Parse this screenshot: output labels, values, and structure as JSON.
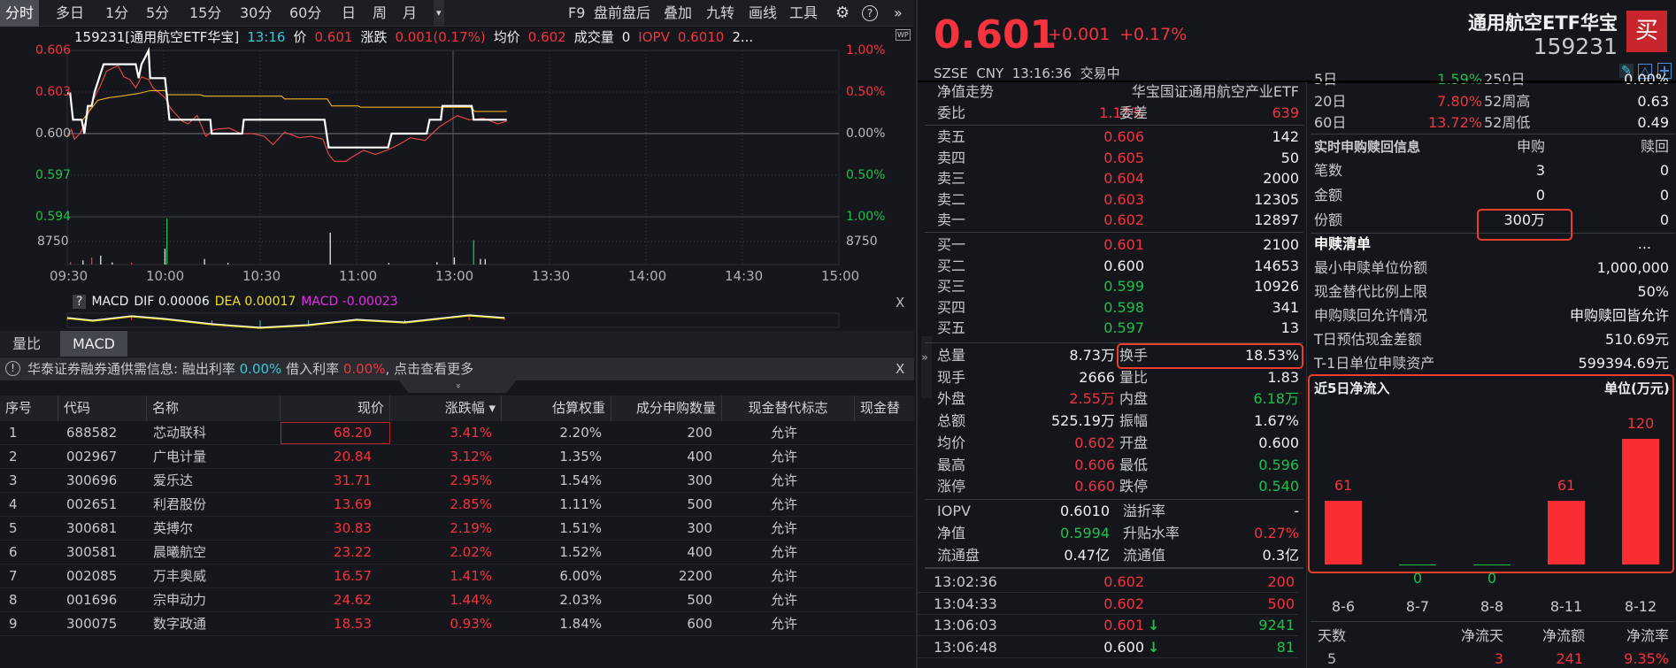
{
  "toolbar": {
    "tabs": [
      "分时",
      "多日",
      "1分",
      "5分",
      "15分",
      "30分",
      "60分",
      "日",
      "周",
      "月"
    ],
    "dropdown": "▾",
    "right_items": [
      "F9",
      "盘前盘后",
      "叠加",
      "九转",
      "画线",
      "工具"
    ],
    "settings_icon": "gear-icon",
    "help": "?",
    "expand": "»"
  },
  "info_line": {
    "code_name": "159231[通用航空ETF华宝]",
    "time": "13:16",
    "price_label": "价",
    "price": "0.601",
    "change_label": "涨跌",
    "change": "0.001(0.17%)",
    "avg_label": "均价",
    "avg": "0.602",
    "volume_label": "成交量",
    "volume": "0",
    "iopv_label": "IOPV",
    "iopv": "0.6010",
    "more": "2..."
  },
  "wp_badge": "WP",
  "macd": {
    "help": "?",
    "name": "MACD",
    "dif_label": "DIF",
    "dif": "0.00006",
    "dea_label": "DEA",
    "dea": "0.00017",
    "macd_label": "MACD",
    "macd": "-0.00023",
    "close": "X"
  },
  "indicator_tabs": [
    "量比",
    "MACD"
  ],
  "notice": {
    "icon": "!",
    "text": "华泰证券融券通供需信息:",
    "lend_label": "融出利率",
    "lend": "0.00%",
    "borrow_label": "借入利率",
    "borrow": "0.00%",
    "more": ", 点击查看更多",
    "close": "X",
    "collapse": "»"
  },
  "table": {
    "columns": [
      "序号",
      "代码",
      "名称",
      "现价",
      "涨跌幅 ▾",
      "估算权重",
      "成分申购数量",
      "现金替代标志",
      "现金替代"
    ],
    "rows": [
      [
        "1",
        "688582",
        "芯动联科",
        "68.20",
        "3.41%",
        "2.20%",
        "200",
        "允许"
      ],
      [
        "2",
        "002967",
        "广电计量",
        "20.84",
        "3.12%",
        "1.35%",
        "400",
        "允许"
      ],
      [
        "3",
        "300696",
        "爱乐达",
        "31.71",
        "2.95%",
        "1.54%",
        "300",
        "允许"
      ],
      [
        "4",
        "002651",
        "利君股份",
        "13.69",
        "2.85%",
        "1.11%",
        "500",
        "允许"
      ],
      [
        "5",
        "300681",
        "英搏尔",
        "30.83",
        "2.19%",
        "1.51%",
        "300",
        "允许"
      ],
      [
        "6",
        "300581",
        "晨曦航空",
        "23.22",
        "2.02%",
        "1.52%",
        "400",
        "允许"
      ],
      [
        "7",
        "002085",
        "万丰奥威",
        "16.57",
        "1.41%",
        "6.00%",
        "2200",
        "允许"
      ],
      [
        "8",
        "001696",
        "宗申动力",
        "24.62",
        "1.44%",
        "2.03%",
        "500",
        "允许"
      ],
      [
        "9",
        "300075",
        "数字政通",
        "18.53",
        "0.93%",
        "1.84%",
        "600",
        "允许"
      ]
    ]
  },
  "quote": {
    "price": "0.601",
    "change": "+0.001",
    "change_pct": "+0.17%",
    "name": "通用航空ETF华宝",
    "code": "159231",
    "buy_button": "买",
    "status": "SZSE  CNY  13:16:36  交易中"
  },
  "nav": {
    "label": "净值走势",
    "fund_name": "华宝国证通用航空产业ETF"
  },
  "commission": {
    "ratio_label": "委比",
    "ratio": "1.15%",
    "diff_label": "委差",
    "diff": "639"
  },
  "asks": [
    [
      "卖五",
      "0.606",
      "142"
    ],
    [
      "卖四",
      "0.605",
      "50"
    ],
    [
      "卖三",
      "0.604",
      "2000"
    ],
    [
      "卖二",
      "0.603",
      "12305"
    ],
    [
      "卖一",
      "0.602",
      "12897"
    ]
  ],
  "bids": [
    [
      "买一",
      "0.601",
      "2100"
    ],
    [
      "买二",
      "0.600",
      "14653"
    ],
    [
      "买三",
      "0.599",
      "10926"
    ],
    [
      "买四",
      "0.598",
      "341"
    ],
    [
      "买五",
      "0.597",
      "13"
    ]
  ],
  "stats": [
    [
      "总量",
      "8.73万",
      "换手",
      "18.53%"
    ],
    [
      "现手",
      "2666",
      "量比",
      "1.83"
    ],
    [
      "外盘",
      "2.55万",
      "内盘",
      "6.18万"
    ],
    [
      "总额",
      "525.19万",
      "振幅",
      "1.67%"
    ],
    [
      "均价",
      "0.602",
      "开盘",
      "0.600"
    ],
    [
      "最高",
      "0.606",
      "最低",
      "0.596"
    ],
    [
      "涨停",
      "0.660",
      "跌停",
      "0.540"
    ]
  ],
  "etf_stats": [
    [
      "IOPV",
      "0.6010",
      "溢折率",
      "-"
    ],
    [
      "净值",
      "0.5994",
      "升贴水率",
      "0.27%"
    ],
    [
      "流通盘",
      "0.47亿",
      "流通值",
      "0.3亿"
    ]
  ],
  "trades": [
    [
      "13:02:36",
      "0.602",
      "",
      "200"
    ],
    [
      "13:04:33",
      "0.602",
      "",
      "500"
    ],
    [
      "13:06:03",
      "0.601",
      "↓",
      "9241"
    ],
    [
      "13:06:48",
      "0.600",
      "↓",
      "81"
    ]
  ],
  "returns": [
    [
      "5日",
      "1.59%",
      "250日",
      "0.00%"
    ],
    [
      "20日",
      "7.80%",
      "52周高",
      "0.63"
    ],
    [
      "60日",
      "13.72%",
      "52周低",
      "0.49"
    ]
  ],
  "creation": {
    "title": "实时申购赎回信息",
    "col_buy": "申购",
    "col_redeem": "赎回",
    "rows": [
      [
        "笔数",
        "3",
        "0"
      ],
      [
        "金额",
        "0",
        "0"
      ],
      [
        "份额",
        "300万",
        "0"
      ]
    ]
  },
  "pcf": {
    "title": "申赎清单",
    "more": "...",
    "rows": [
      [
        "最小申赎单位份额",
        "1,000,000"
      ],
      [
        "现金替代比例上限",
        "50%"
      ],
      [
        "申购赎回允许情况",
        "申购赎回皆允许"
      ],
      [
        "T日预估现金差额",
        "510.69元"
      ],
      [
        "T-1日单位申赎资产",
        "599394.69元"
      ]
    ]
  },
  "inflow_summary": {
    "headers": [
      "天数",
      "净流天",
      "净流额",
      "净流率"
    ],
    "values": [
      "5",
      "3",
      "241",
      "9.35%"
    ]
  },
  "colors": {
    "up": "#f5333f",
    "down": "#1fc04b",
    "price_line": "#ffffff",
    "avg_line": "#f0b020",
    "iopv_line": "#f24848",
    "highlight": "#e8402a"
  },
  "chart_data": [
    {
      "type": "line",
      "title": "分时",
      "x_unit": "minutes since 09:30 (trading time)",
      "x_ticks": [
        "09:30",
        "10:00",
        "10:30",
        "11:00",
        "13:00",
        "13:30",
        "14:00",
        "14:30",
        "15:00"
      ],
      "y_left_ticks": [
        "0.606",
        "0.603",
        "0.600",
        "0.597",
        "0.594"
      ],
      "y_right_ticks": [
        "1.00%",
        "0.50%",
        "0.00%",
        "0.50%",
        "1.00%"
      ],
      "ylim": [
        0.594,
        0.606
      ],
      "prev_close": 0.6,
      "volume_tick": "8750",
      "volume_tick_value": 8750,
      "series": [
        {
          "name": "price",
          "color": "#ffffff",
          "points": [
            [
              0,
              0.6029
            ],
            [
              0.9,
              0.6029
            ],
            [
              1.8,
              0.601
            ],
            [
              4.5,
              0.601
            ],
            [
              5.3,
              0.6
            ],
            [
              6.4,
              0.602
            ],
            [
              7.6,
              0.602
            ],
            [
              8.5,
              0.603
            ],
            [
              11.3,
              0.605
            ],
            [
              21.3,
              0.605
            ],
            [
              22.2,
              0.604
            ],
            [
              23.1,
              0.605
            ],
            [
              24,
              0.6054
            ],
            [
              25.3,
              0.606
            ],
            [
              25.8,
              0.604
            ],
            [
              30.4,
              0.604
            ],
            [
              31.8,
              0.601
            ],
            [
              44.5,
              0.601
            ],
            [
              44.9,
              0.6
            ],
            [
              54.4,
              0.6
            ],
            [
              54.9,
              0.601
            ],
            [
              80,
              0.601
            ],
            [
              81.3,
              0.599
            ],
            [
              99.8,
              0.599
            ],
            [
              100.9,
              0.6
            ],
            [
              111.8,
              0.6
            ],
            [
              112.7,
              0.601
            ],
            [
              116.2,
              0.601
            ],
            [
              116.7,
              0.602
            ],
            [
              125.8,
              0.602
            ],
            [
              126.4,
              0.601
            ],
            [
              136.7,
              0.601
            ]
          ]
        },
        {
          "name": "average",
          "color": "#f0b020",
          "points": [
            [
              2.2,
              0.601
            ],
            [
              4.9,
              0.601
            ],
            [
              6.4,
              0.6015
            ],
            [
              9.5,
              0.6024
            ],
            [
              13.1,
              0.6026
            ],
            [
              16.7,
              0.6027
            ],
            [
              22.2,
              0.6029
            ],
            [
              25.8,
              0.6031
            ],
            [
              30.4,
              0.6031
            ],
            [
              31.3,
              0.6028
            ],
            [
              41.3,
              0.6028
            ],
            [
              42.7,
              0.6027
            ],
            [
              66.7,
              0.6027
            ],
            [
              67.6,
              0.6025
            ],
            [
              80.9,
              0.6025
            ],
            [
              82.2,
              0.602
            ],
            [
              90.4,
              0.602
            ],
            [
              91.3,
              0.6019
            ],
            [
              125.8,
              0.6019
            ],
            [
              126.7,
              0.6016
            ],
            [
              136.7,
              0.6016
            ]
          ]
        },
        {
          "name": "iopv",
          "color": "#f24848",
          "points": [
            [
              0,
              0.5998
            ],
            [
              1.3,
              0.6003
            ],
            [
              2.2,
              0.5996
            ],
            [
              4,
              0.6
            ],
            [
              5.8,
              0.6009
            ],
            [
              7.6,
              0.6022
            ],
            [
              10.4,
              0.6035
            ],
            [
              12.2,
              0.6045
            ],
            [
              15.8,
              0.6049
            ],
            [
              17.6,
              0.6041
            ],
            [
              19.5,
              0.6039
            ],
            [
              21.3,
              0.6033
            ],
            [
              23.1,
              0.6041
            ],
            [
              25.3,
              0.6039
            ],
            [
              26.7,
              0.6033
            ],
            [
              30.4,
              0.6026
            ],
            [
              32.2,
              0.6018
            ],
            [
              35.8,
              0.6009
            ],
            [
              37.6,
              0.6007
            ],
            [
              40.4,
              0.6013
            ],
            [
              43.1,
              0.5998
            ],
            [
              45.8,
              0.6003
            ],
            [
              50.4,
              0.6004
            ],
            [
              54,
              0.6
            ],
            [
              57.6,
              0.6
            ],
            [
              61.3,
              0.5998
            ],
            [
              64,
              0.5992
            ],
            [
              67.6,
              0.6001
            ],
            [
              72.2,
              0.5997
            ],
            [
              75.8,
              0.5998
            ],
            [
              79.5,
              0.5996
            ],
            [
              81.3,
              0.5985
            ],
            [
              83.1,
              0.598
            ],
            [
              86.7,
              0.598
            ],
            [
              88.5,
              0.5983
            ],
            [
              92.2,
              0.5988
            ],
            [
              95.8,
              0.5985
            ],
            [
              99.5,
              0.5988
            ],
            [
              103.1,
              0.5992
            ],
            [
              106.7,
              0.5997
            ],
            [
              111.3,
              0.5995
            ],
            [
              115.8,
              0.6005
            ],
            [
              121.3,
              0.6013
            ],
            [
              124.9,
              0.601
            ],
            [
              129.5,
              0.6011
            ],
            [
              134,
              0.6007
            ],
            [
              136.7,
              0.6009
            ]
          ]
        }
      ],
      "volume": [
        [
          1,
          900,
          "red"
        ],
        [
          4.9,
          1600,
          "white"
        ],
        [
          7.6,
          2700,
          "red"
        ],
        [
          10.4,
          3400,
          "white"
        ],
        [
          14,
          800,
          "white"
        ],
        [
          20,
          700,
          "red"
        ],
        [
          30.4,
          6000,
          "white"
        ],
        [
          31,
          17500,
          "green"
        ],
        [
          42.7,
          2100,
          "white"
        ],
        [
          50,
          600,
          "white"
        ],
        [
          81.8,
          12100,
          "white"
        ],
        [
          100,
          600,
          "white"
        ],
        [
          115,
          900,
          "white"
        ],
        [
          120.4,
          2700,
          "white"
        ],
        [
          126.4,
          9241,
          "green"
        ],
        [
          128.5,
          2100,
          "white"
        ],
        [
          130,
          2100,
          "white"
        ]
      ]
    },
    {
      "type": "bar",
      "title": "近5日净流入",
      "unit_label": "单位(万元)",
      "categories": [
        "8-6",
        "8-7",
        "8-8",
        "8-11",
        "8-12"
      ],
      "values": [
        61,
        0,
        0,
        61,
        120
      ],
      "data_labels": [
        "61",
        "0",
        "0",
        "61",
        "120"
      ]
    }
  ]
}
